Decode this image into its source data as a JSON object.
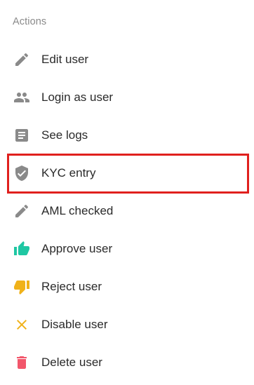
{
  "section": {
    "title": "Actions"
  },
  "actions": [
    {
      "label": "Edit user",
      "icon": "pencil-icon",
      "icon_color": "#8a8a8a"
    },
    {
      "label": "Login as user",
      "icon": "people-icon",
      "icon_color": "#8a8a8a"
    },
    {
      "label": "See logs",
      "icon": "document-icon",
      "icon_color": "#8a8a8a"
    },
    {
      "label": "KYC entry",
      "icon": "shield-check-icon",
      "icon_color": "#8a8a8a",
      "highlighted": true
    },
    {
      "label": "AML checked",
      "icon": "pencil-icon",
      "icon_color": "#8a8a8a"
    },
    {
      "label": "Approve user",
      "icon": "thumb-up-icon",
      "icon_color": "#1fc7a3"
    },
    {
      "label": "Reject user",
      "icon": "thumb-down-icon",
      "icon_color": "#f0b21a"
    },
    {
      "label": "Disable user",
      "icon": "close-icon",
      "icon_color": "#f0b21a"
    },
    {
      "label": "Delete user",
      "icon": "trash-icon",
      "icon_color": "#f2566b"
    }
  ],
  "highlight": {
    "color": "#e0201e",
    "target": "KYC entry"
  }
}
